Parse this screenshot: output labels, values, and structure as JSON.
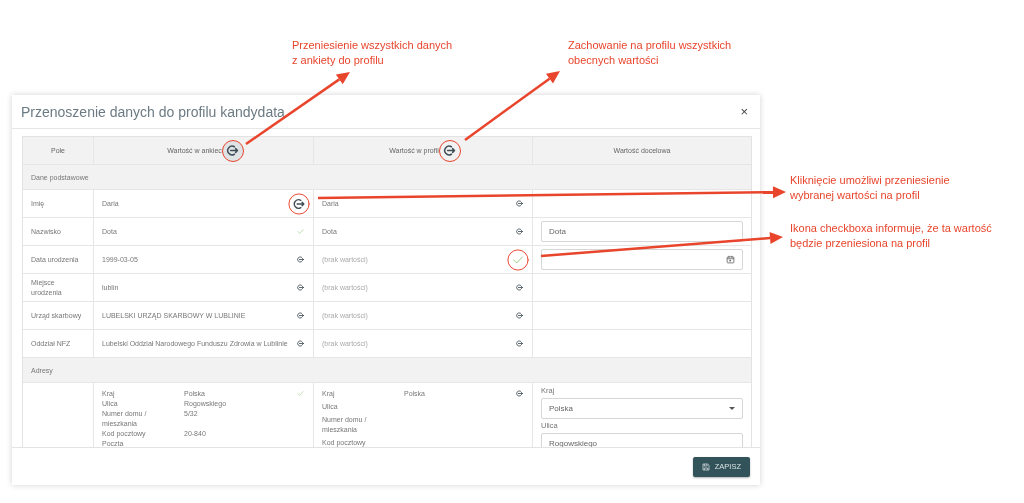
{
  "annotations": [
    {
      "lines": [
        "Przeniesienie wszystkich danych",
        "z ankiety do profilu"
      ]
    },
    {
      "lines": [
        "Zachowanie na profilu wszystkich",
        "obecnych wartości"
      ]
    },
    {
      "lines": [
        "Kliknięcie umożliwi przeniesienie",
        "wybranej wartości na profil"
      ]
    },
    {
      "lines": [
        "Ikona checkboxa informuje, że ta wartość",
        "będzie przeniesiona na profil"
      ]
    }
  ],
  "dialog": {
    "title": "Przenoszenie danych do profilu kandydata",
    "close": "×",
    "columns": [
      {
        "label": "Pole"
      },
      {
        "label": "Wartość w ankiec",
        "icon": {
          "kind": "arrow",
          "highlighted": true
        }
      },
      {
        "label": "Wartość w profil",
        "icon": {
          "kind": "arrow",
          "highlighted": true
        }
      },
      {
        "label": "Wartość docelowa"
      }
    ],
    "rows": [
      {
        "kind": "section",
        "label": "Dane podstawowe"
      },
      {
        "kind": "field",
        "label": "Imię",
        "survey": {
          "value": "Daria",
          "icon": {
            "kind": "arrow",
            "highlighted": true
          }
        },
        "profile": {
          "value": "Daria",
          "missing": false,
          "icon": {
            "kind": "arrow",
            "highlighted": false
          }
        },
        "target": {
          "kind": "none"
        }
      },
      {
        "kind": "field",
        "label": "Nazwisko",
        "survey": {
          "value": "Dota",
          "icon": {
            "kind": "check",
            "highlighted": false
          }
        },
        "profile": {
          "value": "Dota",
          "missing": false,
          "icon": {
            "kind": "arrow",
            "highlighted": false
          }
        },
        "target": {
          "kind": "input",
          "value": "Dota"
        }
      },
      {
        "kind": "field",
        "label": "Data urodzenia",
        "survey": {
          "value": "1999-03-05",
          "icon": {
            "kind": "arrow",
            "highlighted": false
          }
        },
        "profile": {
          "value": "(brak wartości)",
          "missing": true,
          "icon": {
            "kind": "check",
            "highlighted": true
          }
        },
        "target": {
          "kind": "date"
        }
      },
      {
        "kind": "field",
        "label": "Miejsce urodzenia",
        "survey": {
          "value": "lublin",
          "icon": {
            "kind": "arrow",
            "highlighted": false
          }
        },
        "profile": {
          "value": "(brak wartości)",
          "missing": true,
          "icon": {
            "kind": "arrow",
            "highlighted": false
          }
        },
        "target": {
          "kind": "none"
        }
      },
      {
        "kind": "field",
        "label": "Urząd skarbowy",
        "survey": {
          "value": "LUBELSKI URZĄD SKARBOWY W LUBLINIE",
          "icon": {
            "kind": "arrow",
            "highlighted": false
          }
        },
        "profile": {
          "value": "(brak wartości)",
          "missing": true,
          "icon": {
            "kind": "arrow",
            "highlighted": false
          }
        },
        "target": {
          "kind": "none"
        }
      },
      {
        "kind": "field",
        "label": "Oddział NFZ",
        "survey": {
          "value": "Lubelski Oddział Narodowego Funduszu Zdrowia w Lublinie",
          "icon": {
            "kind": "arrow",
            "highlighted": false
          }
        },
        "profile": {
          "value": "(brak wartości)",
          "missing": true,
          "icon": {
            "kind": "arrow",
            "highlighted": false
          }
        },
        "target": {
          "kind": "none"
        }
      },
      {
        "kind": "section",
        "label": "Adresy"
      },
      {
        "kind": "address",
        "survey": {
          "icon": {
            "kind": "check"
          },
          "pairs": [
            {
              "label": "Kraj",
              "value": "Polska"
            },
            {
              "label": "Ulica",
              "value": "Rogowskiego"
            },
            {
              "label": "Numer domu / mieszkania",
              "value": "5/32"
            },
            {
              "label": "Kod pocztowy",
              "value": "20-840"
            },
            {
              "label": "Poczta"
            }
          ]
        },
        "profile": {
          "icon": {
            "kind": "arrow"
          },
          "pairs": [
            {
              "label": "Kraj",
              "value": "Polska"
            },
            {
              "label": "Ulica"
            },
            {
              "label": "Numer domu / mieszkania"
            },
            {
              "label": "Kod pocztowy"
            }
          ]
        },
        "target": [
          {
            "label": "Kraj",
            "kind": "select",
            "value": "Polska"
          },
          {
            "label": "Ulica",
            "kind": "input",
            "value": "Rogowskiego"
          }
        ]
      }
    ],
    "save": "ZAPISZ"
  }
}
